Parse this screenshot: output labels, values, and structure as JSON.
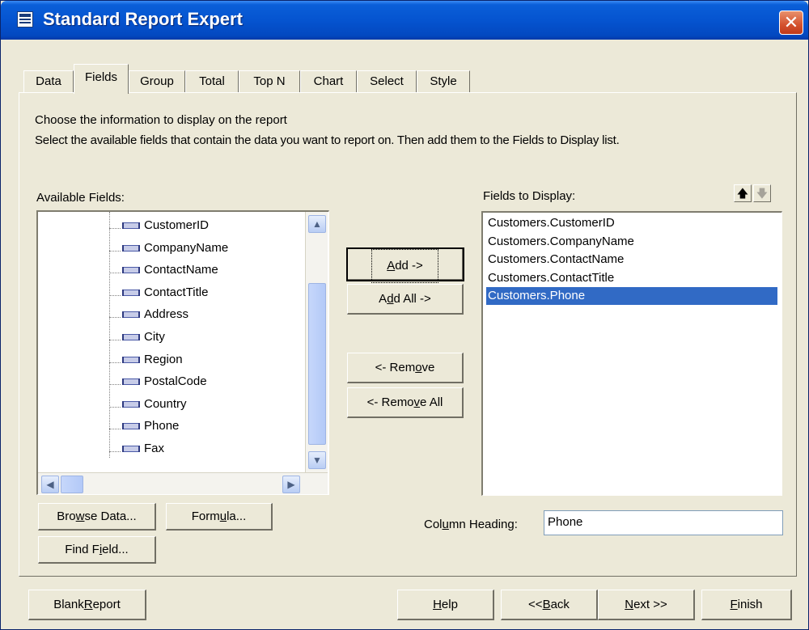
{
  "window": {
    "title": "Standard Report Expert",
    "close_glyph": "✕"
  },
  "tabs": [
    "Data",
    "Fields",
    "Group",
    "Total",
    "Top N",
    "Chart",
    "Select",
    "Style"
  ],
  "active_tab": "Fields",
  "instructions": {
    "line1": "Choose the information to display on the report",
    "line2": "Select the available fields that contain the data you want to report on.  Then add them to the Fields to Display list."
  },
  "available": {
    "label": "Available Fields:",
    "items": [
      "CustomerID",
      "CompanyName",
      "ContactName",
      "ContactTitle",
      "Address",
      "City",
      "Region",
      "PostalCode",
      "Country",
      "Phone",
      "Fax"
    ]
  },
  "display": {
    "label": "Fields to Display:",
    "items": [
      "Customers.CustomerID",
      "Customers.CompanyName",
      "Customers.ContactName",
      "Customers.ContactTitle",
      "Customers.Phone"
    ],
    "selected_index": 4
  },
  "mid_buttons": {
    "add": {
      "pre": "",
      "key": "A",
      "post": "dd ->"
    },
    "add_all": {
      "pre": "A",
      "key": "d",
      "post": "d All ->"
    },
    "remove": {
      "pre": "<- Rem",
      "key": "o",
      "post": "ve"
    },
    "remove_all": {
      "pre": "<- Remo",
      "key": "v",
      "post": "e All"
    }
  },
  "left_buttons": {
    "browse": {
      "pre": "Bro",
      "key": "w",
      "post": "se Data..."
    },
    "formula": {
      "pre": "Form",
      "key": "u",
      "post": "la..."
    },
    "find": {
      "pre": "Find F",
      "key": "i",
      "post": "eld..."
    }
  },
  "column_heading": {
    "pre": "Col",
    "key": "u",
    "post": "mn Heading:",
    "value": "Phone"
  },
  "footer": {
    "blank": {
      "pre": "Blank ",
      "key": "R",
      "post": "eport"
    },
    "help": {
      "pre": "",
      "key": "H",
      "post": "elp"
    },
    "back": {
      "pre": "<< ",
      "key": "B",
      "post": "ack"
    },
    "next": {
      "pre": "",
      "key": "N",
      "post": "ext >>"
    },
    "finish": {
      "pre": "",
      "key": "F",
      "post": "inish"
    }
  },
  "icons": {
    "up": "🡅",
    "down": "🡇",
    "scroll_up": "▲",
    "scroll_down": "▼",
    "scroll_left": "◀",
    "scroll_right": "▶"
  }
}
